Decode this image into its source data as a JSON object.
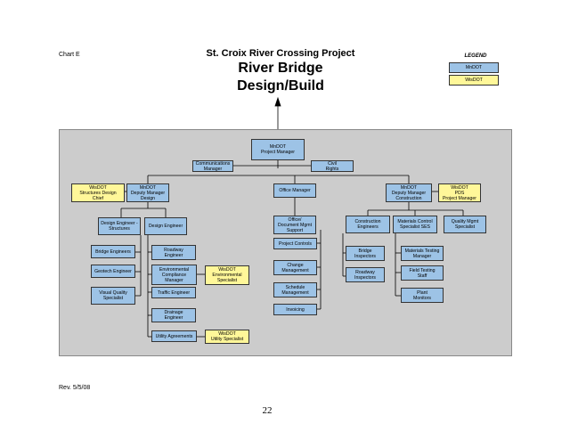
{
  "chart_label": "Chart E",
  "title_line1": "St. Croix River Crossing Project",
  "title_line2": "River Bridge",
  "title_line3": "Design/Build",
  "legend": {
    "title": "LEGEND",
    "mndot": "MnDOT",
    "wisdot": "WisDOT",
    "mndot_color": "#9dc3e6",
    "wisdot_color": "#fff799"
  },
  "boxes": {
    "pm": "MnDOT\nProject Manager",
    "comm": "Communications\nManager",
    "civil": "Civil\nRights",
    "dm_design": "MnDOT\nDeputy Manager\nDesign",
    "wis_struct_chief": "WisDOT\nStructures Design\nChief",
    "office_mgr": "Office Manager",
    "dm_construction": "MnDOT\nDeputy Manager\nConstruction",
    "wis_pds": "WisDOT\nPDS\nProject Manager",
    "design_eng_struct": "Design Engineer -\nStructures",
    "design_eng": "Design Engineer",
    "office_doc": "Office/\nDocument Mgmt\nSupport",
    "construction_eng": "Construction\nEngineers",
    "materials_control": "Materials Control\nSpecialist SES",
    "quality_mgmt": "Quality Mgmt\nSpecialist",
    "bridge_eng": "Bridge Engineers",
    "roadway_eng": "Roadway\nEngineer",
    "project_controls": "Project Controls",
    "bridge_insp": "Bridge\nInspectors",
    "materials_testing": "Materials Testing\nManager",
    "geotech": "Geotech Engineer",
    "env_compliance": "Environmental\nCompliance\nManager",
    "wis_env": "WisDOT\nEnvironmental\nSpecialist",
    "change_mgmt": "Change\nManagement",
    "roadway_insp": "Roadway\nInspectors",
    "field_testing": "Field Testing\nStaff",
    "visual_quality": "Visual Quality\nSpecialist",
    "traffic_eng": "Traffic Engineer",
    "schedule_mgmt": "Schedule\nManagement",
    "plant_monitors": "Plant\nMonitors",
    "drainage_eng": "Drainage\nEngineer",
    "invoicing": "Invoicing",
    "utility_agreements": "Utility Agreements",
    "wis_utility": "WisDOT\nUtility Specialist"
  },
  "revision": "Rev. 5/5/08",
  "page_number": "22"
}
